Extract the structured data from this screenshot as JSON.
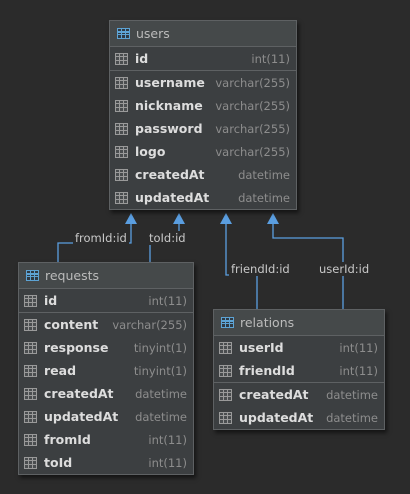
{
  "tables": [
    {
      "name": "users",
      "sections": [
        [
          {
            "name": "id",
            "type": "int(11)"
          }
        ],
        [
          {
            "name": "username",
            "type": "varchar(255)"
          },
          {
            "name": "nickname",
            "type": "varchar(255)"
          },
          {
            "name": "password",
            "type": "varchar(255)"
          },
          {
            "name": "logo",
            "type": "varchar(255)"
          },
          {
            "name": "createdAt",
            "type": "datetime"
          },
          {
            "name": "updatedAt",
            "type": "datetime"
          }
        ]
      ]
    },
    {
      "name": "requests",
      "sections": [
        [
          {
            "name": "id",
            "type": "int(11)"
          }
        ],
        [
          {
            "name": "content",
            "type": "varchar(255)"
          },
          {
            "name": "response",
            "type": "tinyint(1)"
          },
          {
            "name": "read",
            "type": "tinyint(1)"
          },
          {
            "name": "createdAt",
            "type": "datetime"
          },
          {
            "name": "updatedAt",
            "type": "datetime"
          },
          {
            "name": "fromId",
            "type": "int(11)"
          },
          {
            "name": "toId",
            "type": "int(11)"
          }
        ]
      ]
    },
    {
      "name": "relations",
      "sections": [
        [
          {
            "name": "userId",
            "type": "int(11)"
          },
          {
            "name": "friendId",
            "type": "int(11)"
          }
        ],
        [
          {
            "name": "createdAt",
            "type": "datetime"
          },
          {
            "name": "updatedAt",
            "type": "datetime"
          }
        ]
      ]
    }
  ],
  "relationships": [
    {
      "from": "requests",
      "to": "users",
      "label": "fromId:id"
    },
    {
      "from": "requests",
      "to": "users",
      "label": "toId:id"
    },
    {
      "from": "relations",
      "to": "users",
      "label": "friendId:id"
    },
    {
      "from": "relations",
      "to": "users",
      "label": "userId:id"
    }
  ],
  "colors": {
    "background": "#2b2b2b",
    "edge": "#5a9ee0",
    "table_icon": "#5da3d4"
  }
}
